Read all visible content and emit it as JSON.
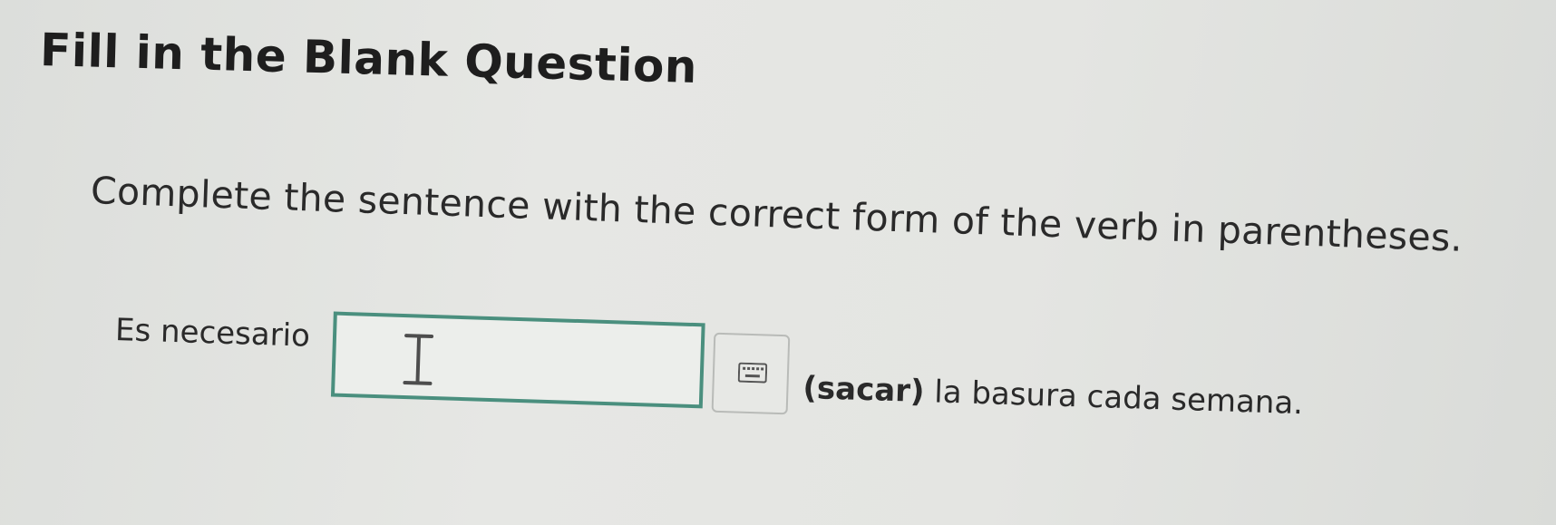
{
  "title": "Fill in the Blank Question",
  "instructions": "Complete the sentence with the correct form of the verb in parentheses.",
  "sentence": {
    "prefix": "Es necesario",
    "answer_value": "",
    "verb": "(sacar)",
    "suffix": " la basura cada semana."
  },
  "icons": {
    "cursor": "text-cursor-icon",
    "keyboard": "keyboard-icon"
  },
  "colors": {
    "input_border": "#4a8f7e",
    "text": "#2a2a2a"
  }
}
